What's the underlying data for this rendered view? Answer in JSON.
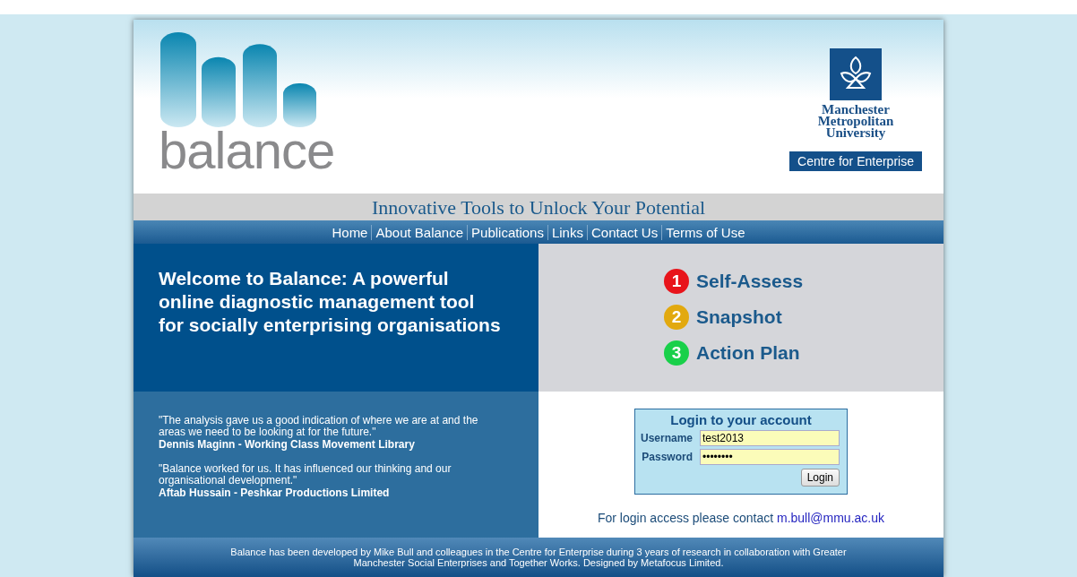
{
  "header": {
    "logo_text": "balance",
    "university": [
      "Manchester",
      "Metropolitan",
      "University"
    ],
    "centre": "Centre for Enterprise"
  },
  "tagline": "Innovative Tools to Unlock Your Potential",
  "nav": [
    "Home",
    "About Balance",
    "Publications",
    "Links",
    "Contact Us",
    "Terms of Use"
  ],
  "welcome": "Welcome to Balance: A powerful online diagnostic management tool for socially enterprising organisations",
  "steps": [
    {
      "number": "1",
      "label": "Self-Assess",
      "color": "#e8141b"
    },
    {
      "number": "2",
      "label": "Snapshot",
      "color": "#e2a90f"
    },
    {
      "number": "3",
      "label": "Action Plan",
      "color": "#19d04a"
    }
  ],
  "testimonials": [
    {
      "quote": "\"The analysis gave us a good indication of where we are at and the areas we need to be looking at for the future.\"",
      "author": "Dennis Maginn - Working Class Movement Library"
    },
    {
      "quote": "\"Balance worked for us. It has influenced our thinking and our organisational development.\"",
      "author": "Aftab Hussain - Peshkar Productions Limited"
    }
  ],
  "login": {
    "title": "Login to your account",
    "username_label": "Username",
    "username": "test2013",
    "password_label": "Password",
    "password": "••••••••",
    "button": "Login",
    "contact_text": "For login access please contact",
    "contact_email": "m.bull@mmu.ac.uk"
  },
  "footer": "Balance has been developed by Mike Bull and colleagues in the Centre for Enterprise during 3 years of research in collaboration with Greater Manchester Social Enterprises and Together Works. Designed by Metafocus Limited."
}
